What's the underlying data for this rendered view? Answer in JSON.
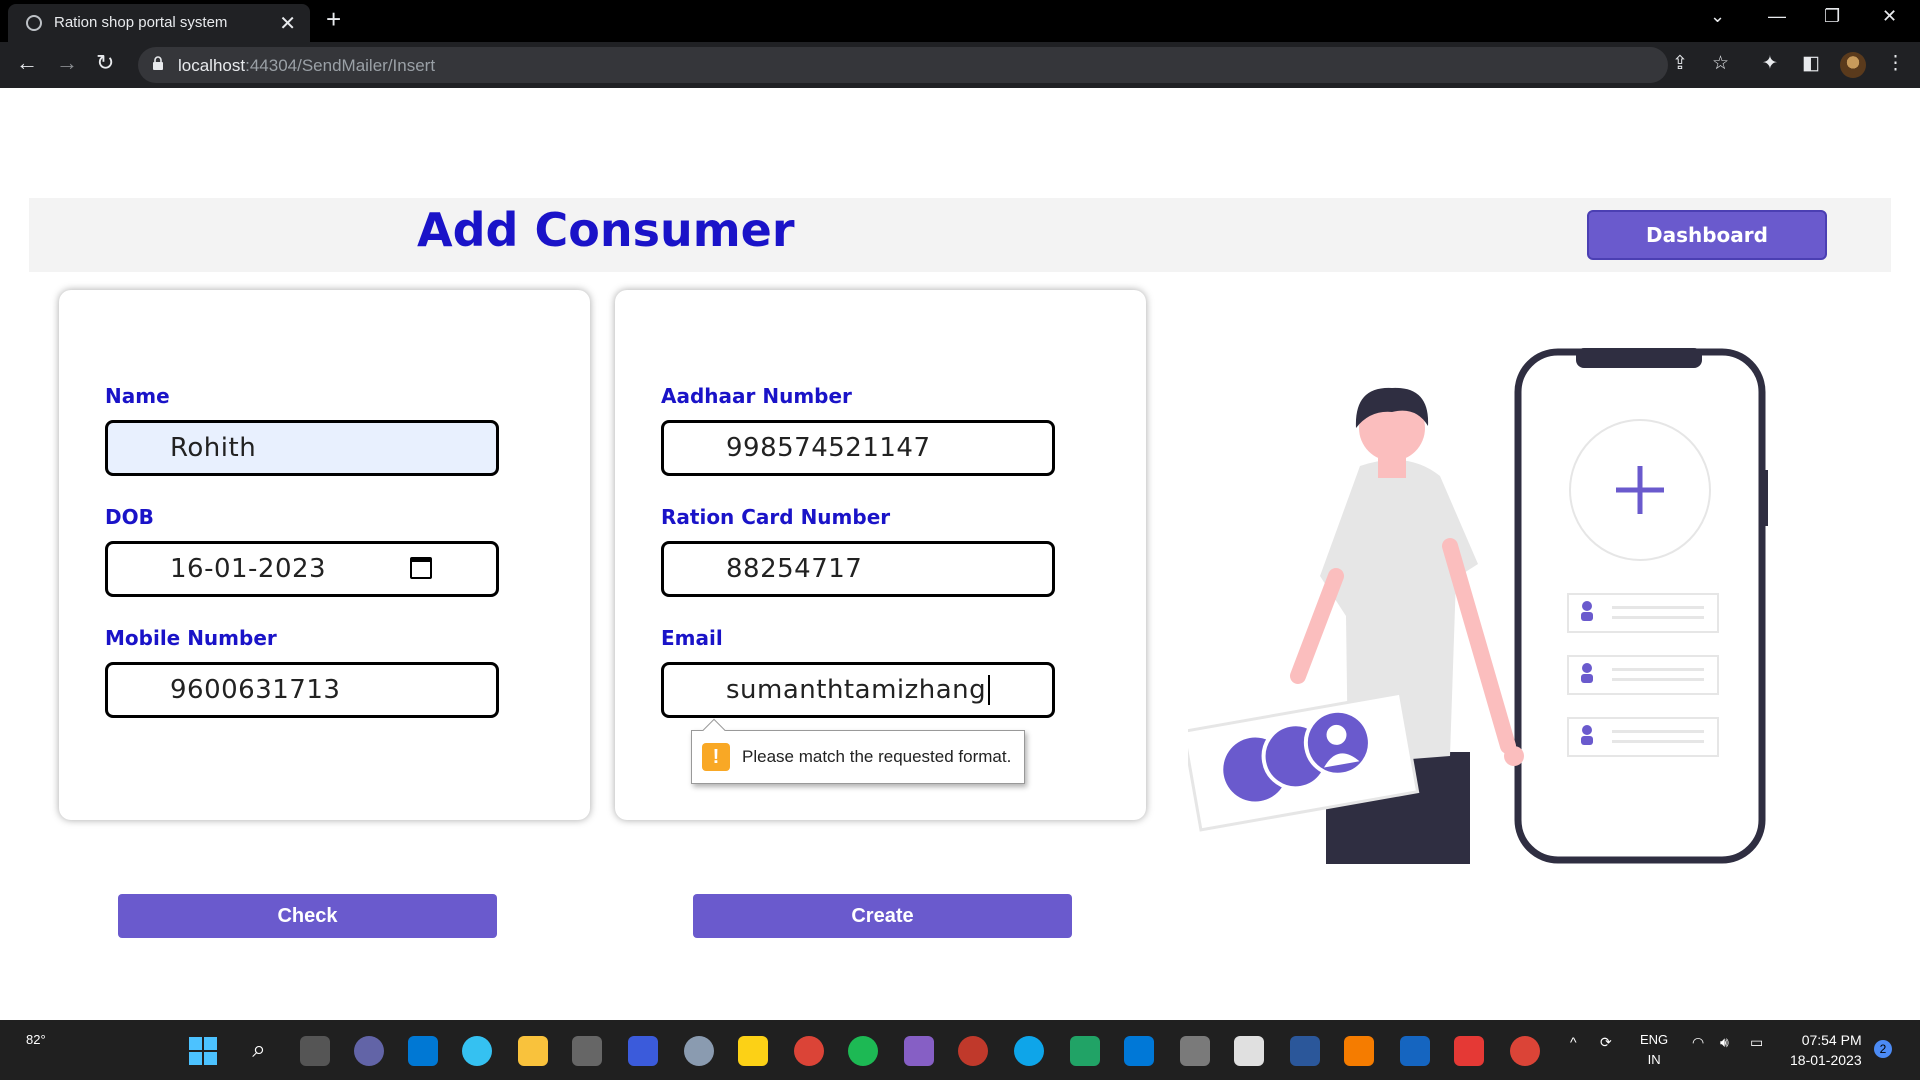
{
  "browser": {
    "tab_title": "Ration shop portal system",
    "url_host": "localhost",
    "url_path": ":44304/SendMailer/Insert"
  },
  "header": {
    "title": "Add Consumer",
    "dashboard_label": "Dashboard"
  },
  "form": {
    "name_label": "Name",
    "name_value": "Rohith",
    "dob_label": "DOB",
    "dob_value": "16-01-2023",
    "mobile_label": "Mobile Number",
    "mobile_value": "9600631713",
    "aadhaar_label": "Aadhaar Number",
    "aadhaar_value": "998574521147",
    "ration_label": "Ration Card Number",
    "ration_value": "88254717",
    "email_label": "Email",
    "email_value": "sumanthtamizhang",
    "validation_message": "Please match the requested format."
  },
  "actions": {
    "check_label": "Check",
    "create_label": "Create"
  },
  "colors": {
    "accent": "#6a5acd",
    "title": "#1a13c8"
  },
  "taskbar": {
    "weather": "82°",
    "lang_top": "ENG",
    "lang_bottom": "IN",
    "time": "07:54 PM",
    "date": "18-01-2023",
    "notification_count": "2"
  }
}
